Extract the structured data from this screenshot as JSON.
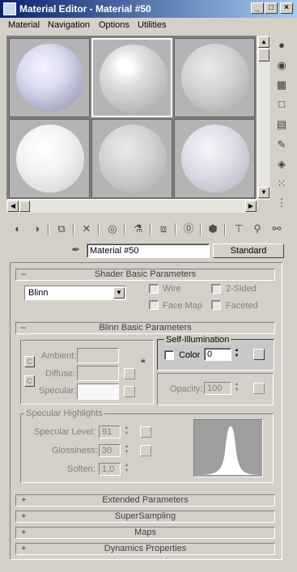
{
  "window": {
    "title": "Material Editor - Material #50",
    "minimize": "_",
    "maximize": "□",
    "close": "×"
  },
  "menu": [
    "Material",
    "Navigation",
    "Options",
    "Utilities"
  ],
  "material": {
    "name": "Material #50",
    "type_button": "Standard"
  },
  "shader_basic": {
    "header": "Shader Basic Parameters",
    "shader": "Blinn",
    "wire": "Wire",
    "two_sided": "2-Sided",
    "face_map": "Face Map",
    "faceted": "Faceted"
  },
  "blinn_basic": {
    "header": "Blinn Basic Parameters",
    "ambient": "Ambient:",
    "diffuse": "Diffuse:",
    "specular": "Specular:",
    "self_illum_title": "Self-Illumination",
    "color_label": "Color",
    "color_value": "0",
    "opacity_label": "Opacity:",
    "opacity_value": "100"
  },
  "specular_highlights": {
    "title": "Specular Highlights",
    "level_label": "Specular Level:",
    "level_value": "91",
    "gloss_label": "Glossiness:",
    "gloss_value": "30",
    "soften_label": "Soften:",
    "soften_value": "1,0"
  },
  "rollouts": {
    "extended": "Extended Parameters",
    "supersampling": "SuperSampling",
    "maps": "Maps",
    "dynamics": "Dynamics Properties"
  },
  "signs": {
    "minus": "–",
    "plus": "+"
  },
  "colors": {
    "title_start": "#0a246a",
    "title_end": "#a6caf0",
    "face": "#d4d0c8"
  }
}
